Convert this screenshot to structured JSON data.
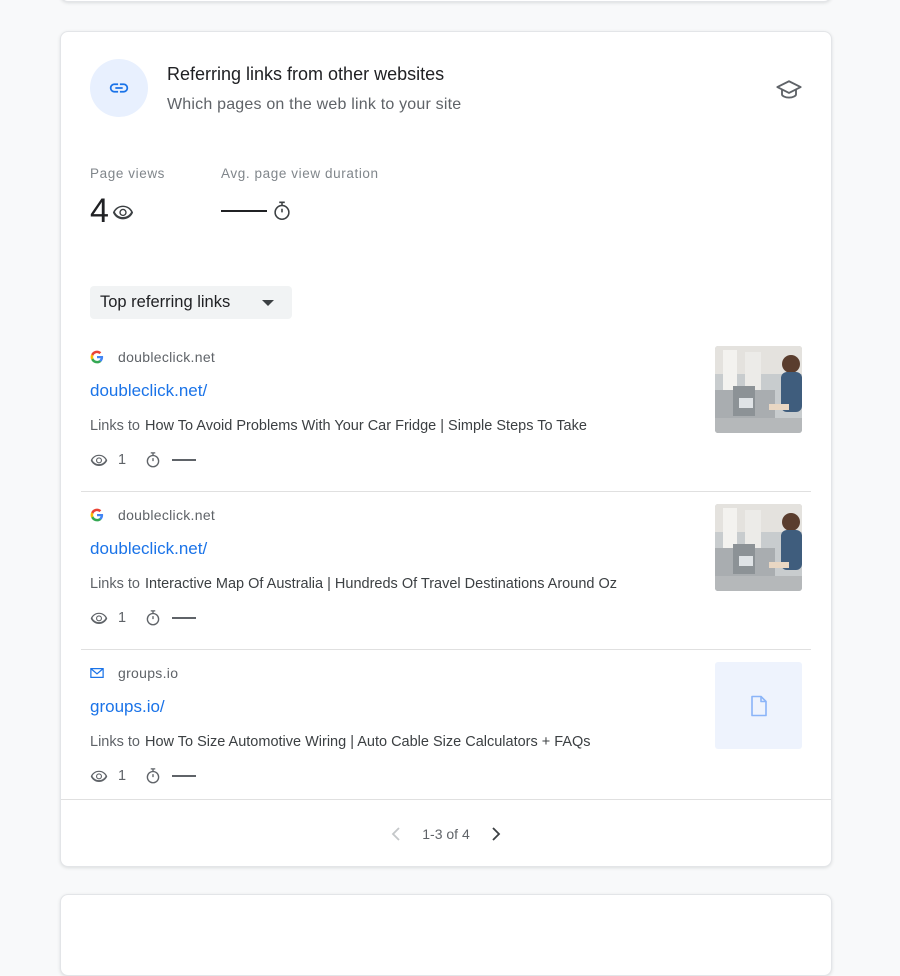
{
  "card": {
    "title": "Referring links from other websites",
    "subtitle": "Which pages on the web link to your site",
    "header_icon": "link-icon",
    "help_icon": "school-icon"
  },
  "metrics": {
    "page_views": {
      "label": "Page views",
      "value": "4",
      "icon": "eye-icon"
    },
    "avg_duration": {
      "label": "Avg. page view duration",
      "value": "—",
      "icon": "timer-icon"
    }
  },
  "dropdown": {
    "label": "Top referring links"
  },
  "links_to_label": "Links to",
  "items": [
    {
      "domain": "doubleclick.net",
      "favicon": "google-g-icon",
      "url": "doubleclick.net/",
      "target": "How To Avoid Problems With Your Car Fridge | Simple Steps To Take",
      "views": "1",
      "duration": "—",
      "thumbnail": "photo"
    },
    {
      "domain": "doubleclick.net",
      "favicon": "google-g-icon",
      "url": "doubleclick.net/",
      "target": "Interactive Map Of Australia | Hundreds Of Travel Destinations Around Oz",
      "views": "1",
      "duration": "—",
      "thumbnail": "photo"
    },
    {
      "domain": "groups.io",
      "favicon": "mail-icon",
      "url": "groups.io/",
      "target": "How To Size Automotive Wiring | Auto Cable Size Calculators + FAQs",
      "views": "1",
      "duration": "—",
      "thumbnail": "document-icon"
    }
  ],
  "pagination": {
    "label": "1-3 of 4"
  },
  "colors": {
    "link": "#1a73e8",
    "accent_bg": "#e8f0fe",
    "text_secondary": "#5f6368"
  }
}
